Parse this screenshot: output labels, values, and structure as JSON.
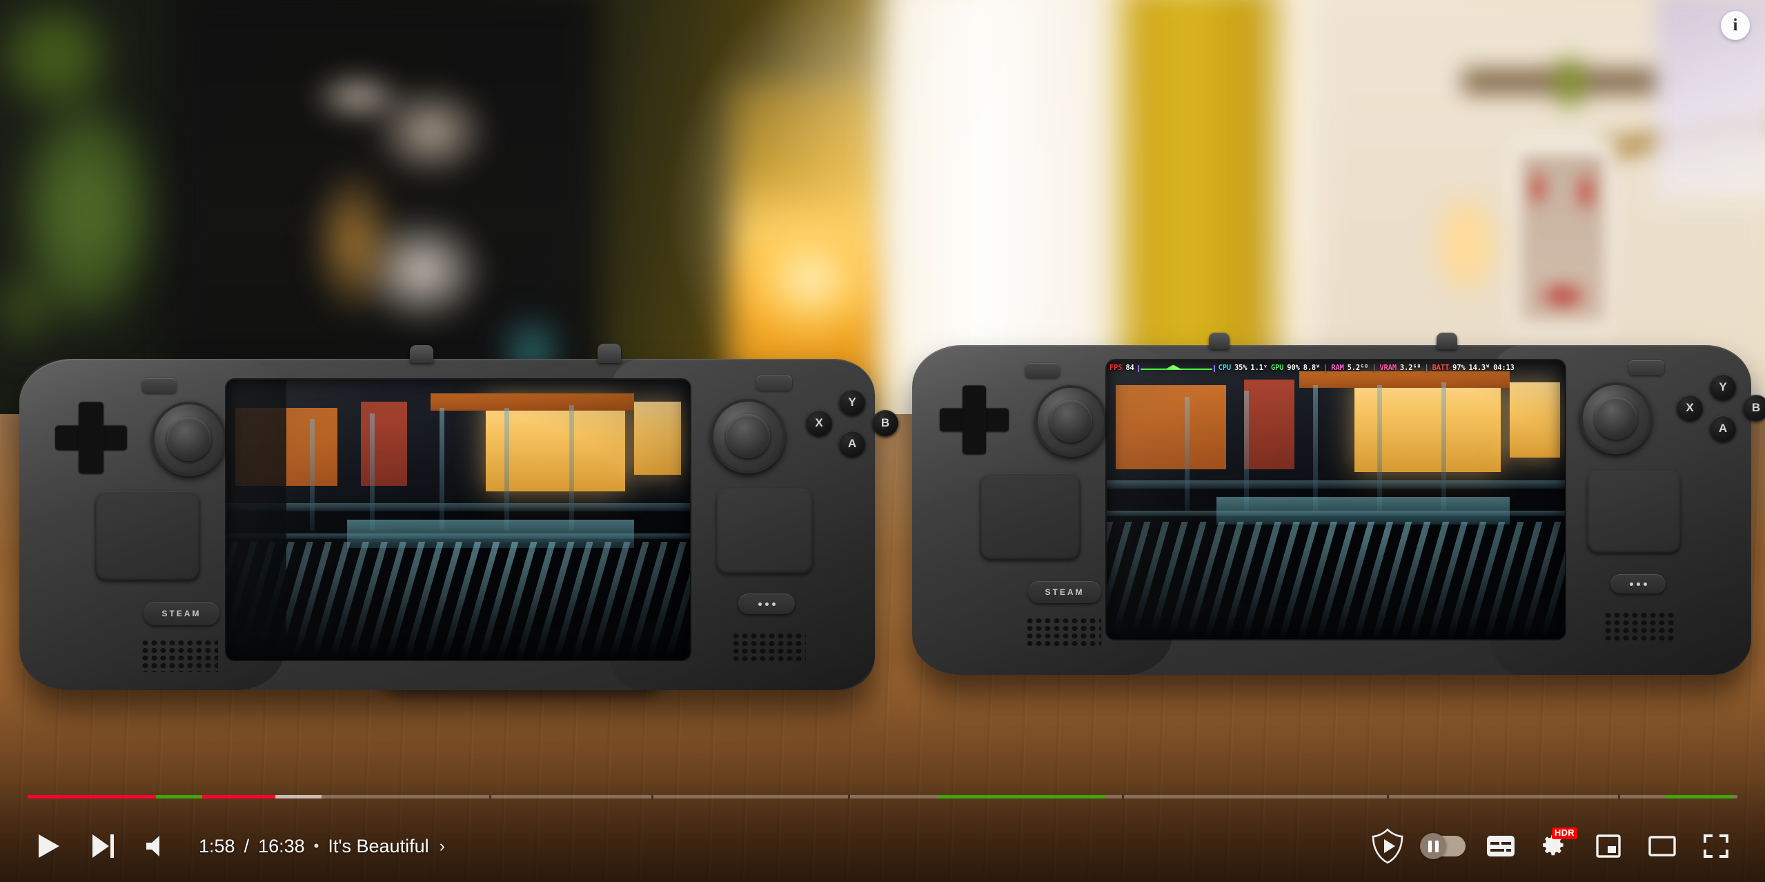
{
  "player": {
    "time_current": "1:58",
    "time_total": "16:38",
    "separator": "/",
    "bullet": "•",
    "chapter_title": "It's Beautiful",
    "chapter_chevron": "›",
    "progress_percent": 11.8,
    "buffered_percent": 17.1,
    "accent_played": "#ff0033",
    "accent_sponsor": "#3ea60e",
    "controls": {
      "play": "Play",
      "next": "Next video",
      "volume": "Volume",
      "premium_shield": "Premium quality",
      "autoplay": "Autoplay is off",
      "subtitles": "Subtitles/closed captions (c)",
      "settings": "Settings",
      "miniplayer": "Miniplayer (i)",
      "theater": "Theater mode (t)",
      "fullscreen": "Full screen (f)",
      "hdr_badge": "HDR",
      "info": "i"
    },
    "segments": [
      {
        "kind": "played",
        "start": 0.0,
        "end": 7.5
      },
      {
        "kind": "sponsor",
        "start": 7.5,
        "end": 10.2
      },
      {
        "kind": "played",
        "start": 10.2,
        "end": 14.5
      },
      {
        "kind": "buffer",
        "start": 14.5,
        "end": 17.2
      },
      {
        "kind": "sponsor",
        "start": 53.2,
        "end": 63.0
      },
      {
        "kind": "sponsor",
        "start": 95.8,
        "end": 99.8
      }
    ],
    "chapter_marks": [
      27.0,
      36.5,
      48.0,
      64.0,
      79.5,
      93.0
    ]
  },
  "scene": {
    "title": "Two Steam Deck handhelds on a wooden table",
    "left_device": {
      "name": "Steam Deck LCD",
      "steam_label": "STEAM",
      "buttons": {
        "y": "Y",
        "x": "X",
        "b": "B",
        "a": "A"
      }
    },
    "right_device": {
      "name": "Steam Deck OLED",
      "steam_label": "STEAM",
      "buttons": {
        "y": "Y",
        "x": "X",
        "b": "B",
        "a": "A"
      }
    }
  },
  "performance_overlay": {
    "fps_label": "FPS",
    "fps_value": "84",
    "cpu_label": "CPU",
    "cpu_usage": "35%",
    "cpu_voltage": "1.1ᵛ",
    "gpu_label": "GPU",
    "gpu_usage": "90%",
    "gpu_power": "8.8ᵂ",
    "ram_label": "RAM",
    "ram_value": "5.2ᴳᴮ",
    "vram_label": "VRAM",
    "vram_value": "3.2ᴳᴮ",
    "batt_label": "BATT",
    "batt_percent": "97%",
    "batt_power": "14.3ᵂ",
    "batt_time": "04:13",
    "separator": "|",
    "colors": {
      "fps": "#ff2d2d",
      "cpu": "#3ddcf5",
      "gpu": "#49e86b",
      "ram": "#ff63d6",
      "vram": "#ff5ab0",
      "batt": "#ff4d4d",
      "value": "#ffffff",
      "graph": "#4dff3c"
    }
  }
}
